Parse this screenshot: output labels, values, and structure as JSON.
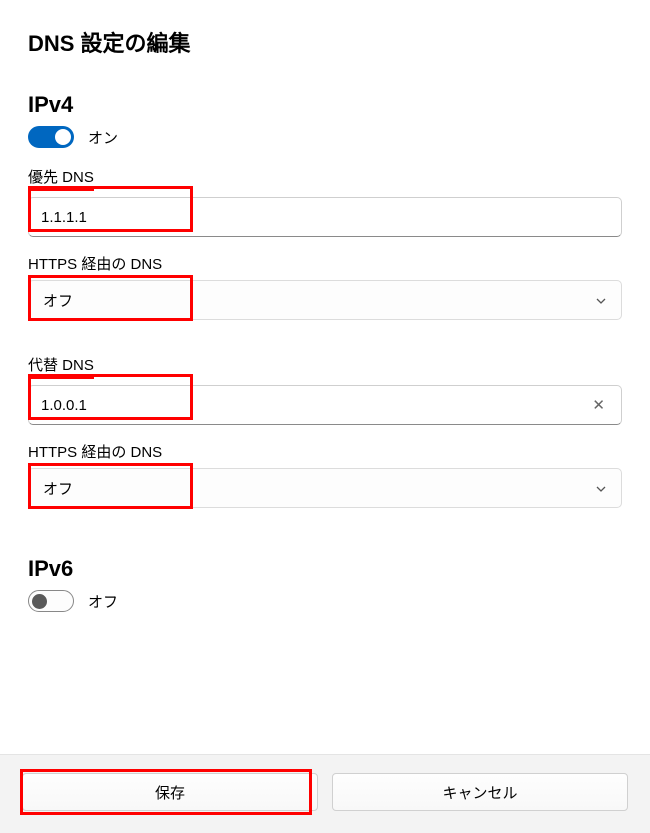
{
  "title": "DNS 設定の編集",
  "ipv4": {
    "heading": "IPv4",
    "toggle_label": "オン",
    "primary_dns_label": "優先 DNS",
    "primary_dns_value": "1.1.1.1",
    "doh1_label": "HTTPS 経由の DNS",
    "doh1_value": "オフ",
    "alt_dns_label": "代替 DNS",
    "alt_dns_value": "1.0.0.1",
    "doh2_label": "HTTPS 経由の DNS",
    "doh2_value": "オフ"
  },
  "ipv6": {
    "heading": "IPv6",
    "toggle_label": "オフ"
  },
  "footer": {
    "save": "保存",
    "cancel": "キャンセル"
  }
}
